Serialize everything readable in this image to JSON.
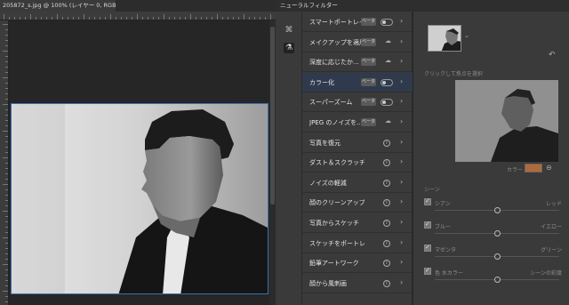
{
  "document": {
    "tab_title": "205872_s.jpg @ 100% (レイヤー 0, RGB/8#) *",
    "close_icon": "×"
  },
  "neural_filters": {
    "panel_title": "ニューラルフィルター",
    "sidebar_icons": [
      "brush-select-icon",
      "flask-icon"
    ],
    "filters": [
      {
        "label": "スマートポートレイト",
        "beta": "ベータ",
        "control": "toggle",
        "selected": false
      },
      {
        "label": "メイクアップを適用",
        "beta": "ベータ",
        "control": "cloud",
        "selected": false
      },
      {
        "label": "深度に応じたか...",
        "beta": "ベータ",
        "control": "cloud",
        "selected": false
      },
      {
        "label": "カラー化",
        "beta": "ベータ",
        "control": "toggle",
        "selected": true
      },
      {
        "label": "スーパーズーム",
        "beta": "ベータ",
        "control": "toggle",
        "selected": false
      },
      {
        "label": "JPEG のノイズを...",
        "beta": "ベータ",
        "control": "cloud",
        "selected": false
      },
      {
        "label": "写真を復元",
        "beta": "",
        "control": "info",
        "selected": false
      },
      {
        "label": "ダスト＆スクラッチ",
        "beta": "",
        "control": "info",
        "selected": false
      },
      {
        "label": "ノイズの軽減",
        "beta": "",
        "control": "info",
        "selected": false
      },
      {
        "label": "顔のクリーンアップ",
        "beta": "",
        "control": "info",
        "selected": false
      },
      {
        "label": "写真からスケッチ",
        "beta": "",
        "control": "info",
        "selected": false
      },
      {
        "label": "スケッチをポートレイトに",
        "beta": "",
        "control": "info",
        "selected": false
      },
      {
        "label": "鉛筆アートワーク",
        "beta": "",
        "control": "info",
        "selected": false
      },
      {
        "label": "顔から風刺画",
        "beta": "",
        "control": "info",
        "selected": false
      }
    ],
    "info_glyph": "i",
    "chevron_glyph": "›",
    "cloud_glyph": "☁"
  },
  "colorize": {
    "click_hint": "クリックして焦点を選択",
    "color_label": "カラー",
    "color_swatch": "#b06a3a",
    "scene_header": "シーン",
    "sliders": [
      {
        "left": "シアン",
        "right": "レッド",
        "value": 0.5,
        "checked": true
      },
      {
        "left": "ブルー",
        "right": "イエロー",
        "value": 0.5,
        "checked": true
      },
      {
        "left": "マゼンタ",
        "right": "グリーン",
        "value": 0.5,
        "checked": true
      },
      {
        "left": "色 水カラー",
        "right": "シーンの彩度",
        "value": 0.5,
        "checked": true
      }
    ]
  },
  "colors": {
    "accent_selection": "#3d6fb5",
    "panel_bg": "#3a3a3a"
  }
}
